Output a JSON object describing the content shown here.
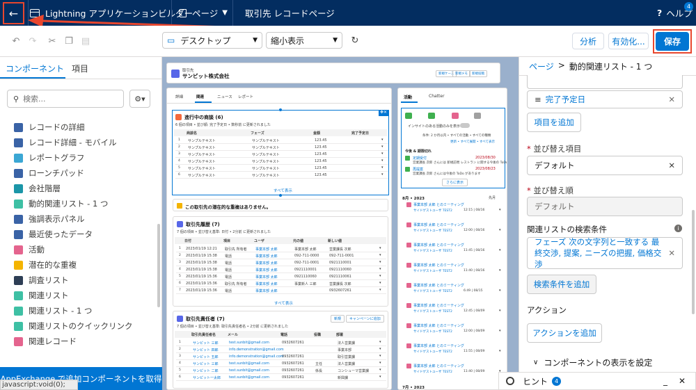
{
  "header": {
    "app_title": "Lightning アプリケーションビルダー",
    "page_menu": "ページ",
    "record_page": "取引先 レコードページ",
    "help": "ヘルプ",
    "help_badge": "4"
  },
  "toolbar": {
    "device": "デスクトップ",
    "zoom": "縮小表示",
    "analyze": "分析",
    "activate": "有効化...",
    "save": "保存"
  },
  "left": {
    "tab_components": "コンポーネント",
    "tab_fields": "項目",
    "search_placeholder": "検索...",
    "items": [
      {
        "label": "レコードの詳細",
        "color": "#3a63a6"
      },
      {
        "label": "レコード詳細 - モバイル",
        "color": "#3a63a6"
      },
      {
        "label": "レポートグラフ",
        "color": "#3ba7d4"
      },
      {
        "label": "ローンチパッド",
        "color": "#3a63a6"
      },
      {
        "label": "会社階層",
        "color": "#1b96a8"
      },
      {
        "label": "動的関連リスト - 1 つ",
        "color": "#3ec0a4"
      },
      {
        "label": "強調表示パネル",
        "color": "#3a63a6"
      },
      {
        "label": "最近使ったデータ",
        "color": "#3a63a6"
      },
      {
        "label": "活動",
        "color": "#e4648e"
      },
      {
        "label": "潜在的な重複",
        "color": "#f4b400"
      },
      {
        "label": "調査リスト",
        "color": "#2e3e55"
      },
      {
        "label": "関連リスト",
        "color": "#3ec0a4"
      },
      {
        "label": "関連リスト - 1 つ",
        "color": "#3ec0a4"
      },
      {
        "label": "関連リストのクイックリンク",
        "color": "#3ec0a4"
      },
      {
        "label": "関連レコード",
        "color": "#e4648e"
      }
    ],
    "appexchange": "AppExchange で追加コンポーネントを取得"
  },
  "canvas": {
    "record_type": "取引先",
    "record_name": "サンピット株式会社",
    "header_buttons": [
      "新規ケース",
      "新規メモ",
      "新規投稿"
    ],
    "tabs": [
      "詳細",
      "関連",
      "ニュース",
      "レポート"
    ],
    "card1": {
      "title": "進行中の商談 (6)",
      "sub": "6 個の項目 • 並び順: 完了予定日 • 数秒前 に更新されました",
      "cols": [
        "商談名",
        "フェーズ",
        "金額",
        "完了予定日"
      ],
      "rows": [
        [
          "サンプルテキスト",
          "サンプルテキスト",
          "123.45"
        ],
        [
          "サンプルテキスト",
          "サンプルテキスト",
          "123.45"
        ],
        [
          "サンプルテキスト",
          "サンプルテキスト",
          "123.45"
        ],
        [
          "サンプルテキスト",
          "サンプルテキスト",
          "123.45"
        ],
        [
          "サンプルテキスト",
          "サンプルテキスト",
          "123.45"
        ],
        [
          "サンプルテキスト",
          "サンプルテキスト",
          "123.45"
        ]
      ],
      "viewall": "すべて表示"
    },
    "card2": {
      "title": "この取引先の潜在的な重複はありません。"
    },
    "card3": {
      "title": "取引先履歴 (7)",
      "sub": "7 個の項目 • 並び替え基準: 日付 • 2分前 に更新されました",
      "cols": [
        "日付",
        "項目",
        "ユーザ",
        "元の値",
        "新しい値"
      ],
      "rows": [
        [
          "2023/01/19 12:21",
          "取引先 所有者",
          "事業本部 太郎",
          "事業本部 太郎",
          "営業課長 次郎"
        ],
        [
          "2023/01/19 15:38",
          "電話",
          "事業本部 太郎",
          "092-711-0000",
          "092-711-0001"
        ],
        [
          "2023/01/19 15:38",
          "電話",
          "事業本部 太郎",
          "092-711-0001",
          "0921110001"
        ],
        [
          "2023/01/19 15:38",
          "電話",
          "事業本部 太郎",
          "0921110001",
          "0921110060"
        ],
        [
          "2023/01/19 15:36",
          "電話",
          "事業本部 太郎",
          "0921110060",
          "0921110061"
        ],
        [
          "2023/01/19 15:36",
          "取引先 所有者",
          "事業本部 太郎",
          "事業新人 三郎",
          "営業課長 次郎"
        ],
        [
          "2023/01/19 15:36",
          "電話",
          "事業本部 太郎",
          "",
          "0932607261"
        ]
      ],
      "viewall": "すべて表示"
    },
    "card4": {
      "title": "取引先責任者 (7)",
      "sub": "7 個の項目 • 並び替え基準: 取引先責任者名 • 2分前 に更新されました",
      "buttons": [
        "新規",
        "キャンペーンに追加"
      ],
      "cols": [
        "取引先責任者名",
        "メール",
        "電話",
        "役職",
        "部署"
      ],
      "rows": [
        [
          "サンピット 三郎",
          "test.sunbit@gmail.com",
          "0932607261",
          "",
          "法人営業課"
        ],
        [
          "サンピット 四郎",
          "info.demonstration@gmail.com",
          "",
          "",
          "事業本部"
        ],
        [
          "サンピット 五郎",
          "info.demonstration@gmail.com",
          "0932607261",
          "",
          "取引営業課"
        ],
        [
          "サンピット 三郎",
          "test.sunbit@gmail.com",
          "0932607261",
          "主任",
          "法人営業課"
        ],
        [
          "サンピット 二郎",
          "test.sunbit@gmail.com",
          "0932607261",
          "係長",
          "コンシューマ営業課"
        ],
        [
          "サンピット一太郎",
          "test.sunbit@gmail.com",
          "0932607261",
          "",
          "新興課"
        ]
      ]
    },
    "activity": {
      "tabs": [
        "活動",
        "Chatter"
      ],
      "toggle_label": "インサイトのある活動のみを表示",
      "filter": "条件: 2 か月以内 • すべての活動 • すべての種類",
      "links": "更新 • すべて展開 • すべて表示",
      "upcoming": "今後 & 期限切れ",
      "tasks": [
        {
          "title": "定期受付",
          "date": "2023/08/30",
          "sub": "営業課長 次郎 さんには 新規訪問 レストラン に関する今後の ToDo があります"
        },
        {
          "title": "再提案",
          "date": "2023/08/23",
          "sub": "営業課長 次郎 さんには今後の ToDo があります"
        }
      ],
      "more_button": "さらに表示",
      "month1": "8月 • 2023",
      "month1_right": "先月",
      "meeting_title": "事業本部 太郎 とのミーティング",
      "meeting_sub": "サイドゲストユーザ TEST2",
      "meeting_times": [
        "12:15 | 08/16",
        "12:00 | 08/16",
        "11:45 | 08/16",
        "11:40 | 08/16",
        "6:49 | 08/15",
        "12:45 | 08/09",
        "12:00 | 08/09",
        "11:55 | 08/09",
        "11:40 | 08/09"
      ],
      "month2": "7月 • 2023"
    }
  },
  "right": {
    "breadcrumb_page": "ページ",
    "breadcrumb_sep": ">",
    "breadcrumb_current": "動的関連リスト - 1 つ",
    "field_item": "完了予定日",
    "add_field": "項目を追加",
    "sort_field_label": "並び替え項目",
    "sort_field_value": "デフォルト",
    "sort_order_label": "並び替え順",
    "sort_order_value": "デフォルト",
    "filter_label": "関連リストの検索条件",
    "filter_value": "フェーズ 次の文字列と一致する 最終交渉, 提案, ニーズの把握, 価格交渉",
    "add_filter": "検索条件を追加",
    "actions_label": "アクション",
    "add_action": "アクションを追加",
    "visibility": "コンポーネントの表示を設定"
  },
  "hint": {
    "label": "ヒント",
    "badge": "4"
  },
  "status_bar": "javascript:void(0);",
  "colors": {
    "header": "#032d60",
    "brand": "#0176d3",
    "annotation": "#e8462e"
  }
}
